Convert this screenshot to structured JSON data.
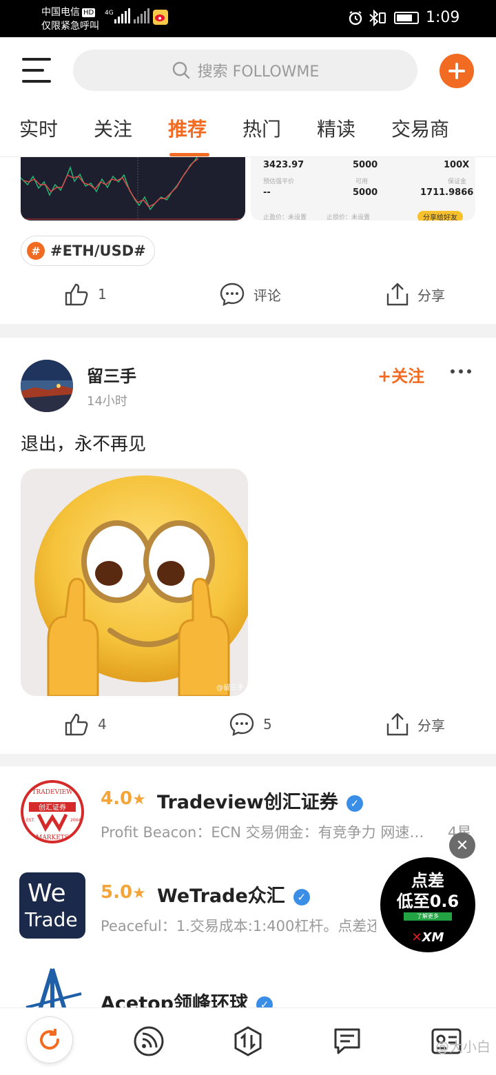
{
  "status_bar": {
    "carrier": "中国电信",
    "hd": "HD",
    "emergency": "仅限紧急呼叫",
    "network": "4G",
    "time": "1:09"
  },
  "header": {
    "search_placeholder": "搜索 FOLLOWME"
  },
  "tabs": [
    "实时",
    "关注",
    "推荐",
    "热门",
    "精读",
    "交易商"
  ],
  "active_tab": "推荐",
  "trade_panel": {
    "price": "3423.97",
    "available": "5000",
    "leverage": "100X",
    "label_forced_price": "预估强平价",
    "label_available": "可用",
    "label_margin": "保证金",
    "forced_price": "--",
    "available2": "5000",
    "margin": "1711.9866",
    "stop_profit": "止盈价：未设置",
    "stop_loss": "止损价：未设置",
    "share_friend": "分享给好友"
  },
  "post1": {
    "tag": "#ETH/USD#",
    "likes": "1",
    "comments_label": "评论",
    "share_label": "分享"
  },
  "post2": {
    "author": "留三手",
    "time": "14小时",
    "follow": "+关注",
    "text": "退出，永不再见",
    "image_watermark": "@留三手",
    "likes": "4",
    "comments": "5",
    "share_label": "分享"
  },
  "brokers": [
    {
      "score": "4.0",
      "name": "Tradeview创汇证券",
      "desc": "Profit Beacon：ECN 交易佣金：有竞争力 网速…",
      "extra": "4星"
    },
    {
      "score": "5.0",
      "name": "WeTrade众汇",
      "desc": "Peaceful：1.交易成本:1:400杠杆。点差还"
    },
    {
      "score": "",
      "name": "Acetop领峰环球",
      "desc": ""
    }
  ],
  "broker_logos": {
    "tradeview_top": "TRADEVIEW",
    "tradeview_cn": "创汇证券",
    "tradeview_bottom": "MARKETS",
    "tradeview_est": "EST.",
    "tradeview_year": "2004",
    "wetrade_1": "We",
    "wetrade_2": "Trade"
  },
  "ad": {
    "line1": "点差",
    "line2": "低至0.6",
    "button": "了解更多",
    "brand": "XM"
  },
  "corner_watermark": "@大小白",
  "colors": {
    "accent": "#f26b22",
    "score": "#f3a53a",
    "verified": "#3a8ee6"
  }
}
